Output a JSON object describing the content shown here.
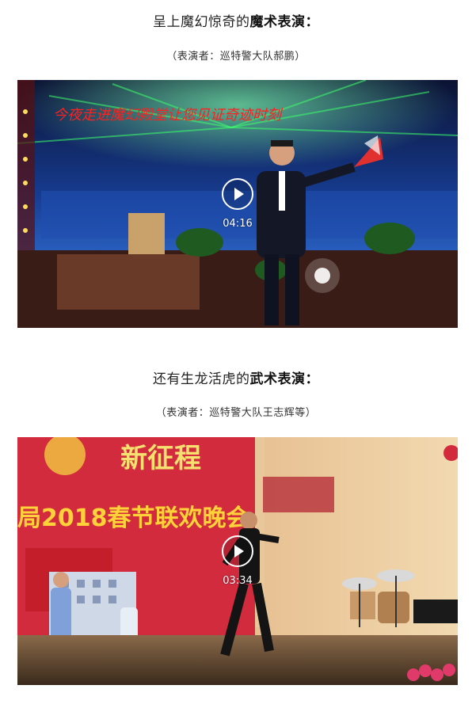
{
  "sections": [
    {
      "heading_prefix": "呈上魔幻惊奇的",
      "heading_bold": "魔术表演",
      "heading_suffix": "：",
      "credit": "（表演者：巡特警大队郝鹏）",
      "video": {
        "duration": "04:16",
        "stage_banner_text": "今夜走进魔幻殿堂让您见证奇迹时刻"
      }
    },
    {
      "heading_prefix": "还有生龙活虎的",
      "heading_bold": "武术表演",
      "heading_suffix": "：",
      "credit": "（表演者：巡特警大队王志辉等）",
      "video": {
        "duration": "03:34",
        "banner_title": "新征程",
        "banner_subtitle": "局2018春节联欢晚会"
      }
    }
  ],
  "colors": {
    "stage_blue": "#1a3a8a",
    "laser_green": "#3cff6a",
    "banner_red": "#d22b3e",
    "wall_cream": "#e8c79a"
  }
}
